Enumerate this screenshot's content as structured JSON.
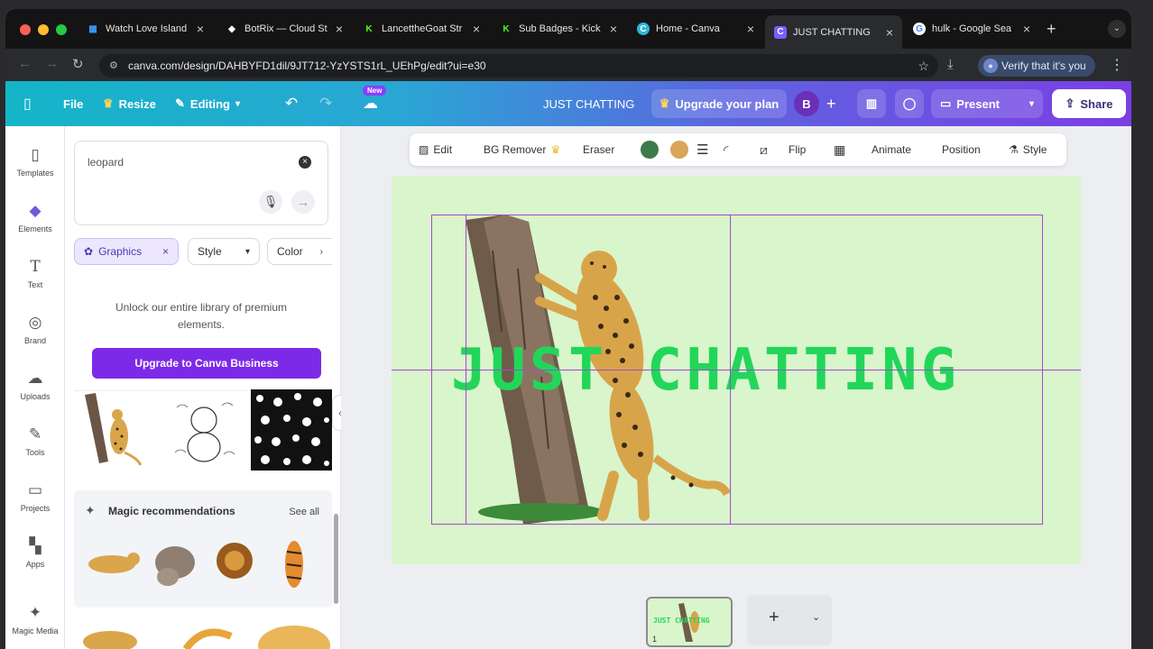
{
  "browser": {
    "tabs": [
      {
        "title": "Watch Love Island",
        "icon": "grid-icon",
        "color": "#3aa0ff"
      },
      {
        "title": "BotRix — Cloud St",
        "icon": "botrix-icon",
        "color": "#ffffff"
      },
      {
        "title": "LancettheGoat Str",
        "icon": "kick-icon",
        "color": "#53fc18"
      },
      {
        "title": "Sub Badges - Kick",
        "icon": "kick-icon",
        "color": "#53fc18"
      },
      {
        "title": "Home - Canva",
        "icon": "canva-icon",
        "color": "#2fb5d6"
      },
      {
        "title": "JUST CHATTING",
        "icon": "canva-icon",
        "color": "#7b5cff"
      },
      {
        "title": "hulk - Google Sea",
        "icon": "google-icon",
        "color": "#4285f4"
      }
    ],
    "url": "canva.com/design/DAHBYFD1dil/9JT712-YzYSTS1rL_UEhPg/edit?ui=e30",
    "verify_label": "Verify that it's you"
  },
  "header": {
    "file": "File",
    "resize": "Resize",
    "editing": "Editing",
    "new_badge": "New",
    "doc_title": "JUST CHATTING",
    "upgrade": "Upgrade your plan",
    "avatar": "B",
    "present": "Present",
    "share": "Share"
  },
  "rail": [
    {
      "label": "Templates",
      "icon": "templates-icon"
    },
    {
      "label": "Elements",
      "icon": "elements-icon"
    },
    {
      "label": "Text",
      "icon": "text-icon"
    },
    {
      "label": "Brand",
      "icon": "brand-icon"
    },
    {
      "label": "Uploads",
      "icon": "uploads-icon"
    },
    {
      "label": "Tools",
      "icon": "tools-icon"
    },
    {
      "label": "Projects",
      "icon": "projects-icon"
    },
    {
      "label": "Apps",
      "icon": "apps-icon"
    },
    {
      "label": "Magic Media",
      "icon": "magic-media-icon"
    }
  ],
  "panel": {
    "search_value": "leopard",
    "chips": {
      "graphics": "Graphics",
      "style": "Style",
      "color": "Color"
    },
    "upsell_text": "Unlock our entire library of premium elements.",
    "upsell_button": "Upgrade to Canva Business",
    "magic_title": "Magic recommendations",
    "see_all": "See all"
  },
  "context_toolbar": {
    "edit": "Edit",
    "bg_remover": "BG Remover",
    "eraser": "Eraser",
    "flip": "Flip",
    "animate": "Animate",
    "position": "Position",
    "style": "Style",
    "swatches": [
      "#3f7a4a",
      "#d9a55a"
    ]
  },
  "canvas": {
    "headline": "JUST CHATTING",
    "background": "#d9f5cb",
    "text_color": "#22d65a",
    "page_number": "1"
  }
}
